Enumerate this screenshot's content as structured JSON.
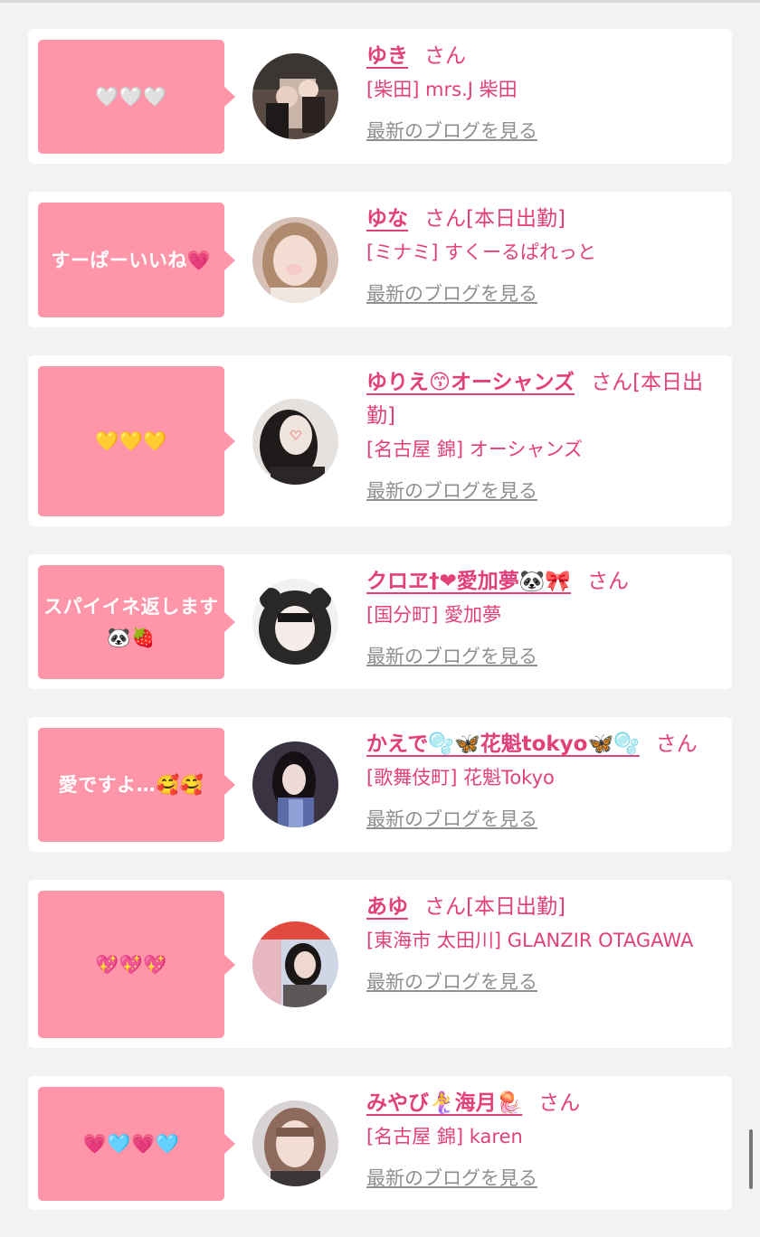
{
  "posts": [
    {
      "comment": "🤍🤍🤍",
      "name": "ゆき",
      "san": "さん",
      "status": "",
      "shop": "[柴田] mrs.J 柴田",
      "blog_link": "最新のブログを見る"
    },
    {
      "comment": "すーぱーいいね💗",
      "name": "ゆな",
      "san": "さん",
      "status": "[本日出勤]",
      "shop": "[ミナミ] すくーるぱれっと",
      "blog_link": "最新のブログを見る"
    },
    {
      "comment": "💛💛💛",
      "name": "ゆりえ😙オーシャンズ",
      "san": "さん",
      "status": "[本日出勤]",
      "shop": "[名古屋 錦] オーシャンズ",
      "blog_link": "最新のブログを見る"
    },
    {
      "comment": "スパイイネ返します🐼🍓",
      "name": "クロヱ†❤︎愛加夢🐼🎀",
      "san": "さん",
      "status": "",
      "shop": "[国分町] 愛加夢",
      "blog_link": "最新のブログを見る"
    },
    {
      "comment": "愛ですよ…🥰🥰",
      "name": "かえで🫧🦋花魁tokyo🦋🫧",
      "san": "さん",
      "status": "",
      "shop": "[歌舞伎町] 花魁Tokyo",
      "blog_link": "最新のブログを見る"
    },
    {
      "comment": "💖💖💖",
      "name": "あゆ",
      "san": "さん",
      "status": "[本日出勤]",
      "shop": "[東海市 太田川] GLANZIR OTAGAWA",
      "blog_link": "最新のブログを見る"
    },
    {
      "comment": "💗🩵💗🩵",
      "name": "みやび🧜‍♀️海月🪼",
      "san": "さん",
      "status": "",
      "shop": "[名古屋 錦] karen",
      "blog_link": "最新のブログを見る"
    }
  ],
  "colors": {
    "bubble": "#ff95a8",
    "accent": "#e2407a",
    "link_gray": "#8f8f8f",
    "page_bg": "#f2f2f2"
  }
}
